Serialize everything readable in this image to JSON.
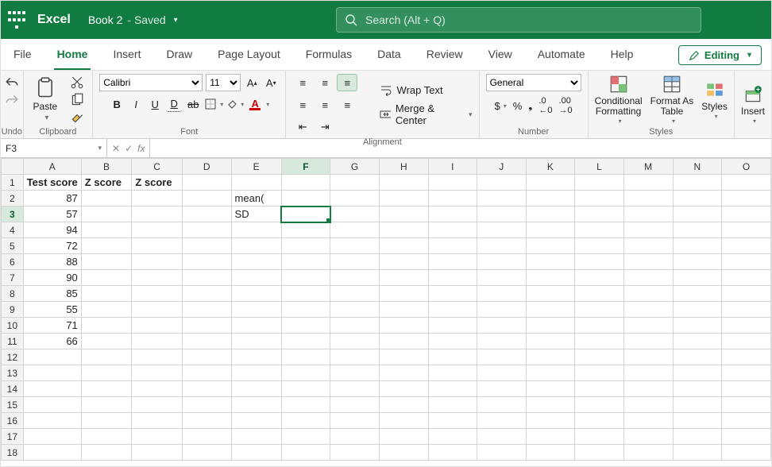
{
  "app": {
    "name": "Excel",
    "doc": "Book 2",
    "saved_label": "- Saved"
  },
  "search": {
    "placeholder": "Search (Alt + Q)"
  },
  "tabs": [
    "File",
    "Home",
    "Insert",
    "Draw",
    "Page Layout",
    "Formulas",
    "Data",
    "Review",
    "View",
    "Automate",
    "Help"
  ],
  "active_tab_index": 1,
  "mode_button": "Editing",
  "ribbon_groups": {
    "undo": "Undo",
    "clipboard": "Clipboard",
    "font": "Font",
    "alignment": "Alignment",
    "number": "Number",
    "styles": "Styles",
    "insert": "Insert"
  },
  "clipboard": {
    "paste": "Paste"
  },
  "font": {
    "name": "Calibri",
    "size": "11"
  },
  "alignment": {
    "wrap": "Wrap Text",
    "merge": "Merge & Center"
  },
  "number": {
    "format": "General"
  },
  "styles": {
    "cond": "Conditional\nFormatting",
    "fmt_tbl": "Format As\nTable",
    "cell": "Styles"
  },
  "cells": {
    "insert": "Insert"
  },
  "namebox": "F3",
  "fx_label": "fx",
  "columns": [
    "A",
    "B",
    "C",
    "D",
    "E",
    "F",
    "G",
    "H",
    "I",
    "J",
    "K",
    "L",
    "M",
    "N",
    "O"
  ],
  "row_count": 18,
  "selected": {
    "col": "F",
    "row": 3
  },
  "cells_data": {
    "A1": {
      "v": "Test score",
      "bold": true,
      "align": "left"
    },
    "B1": {
      "v": "Z score",
      "bold": true,
      "align": "left"
    },
    "C1": {
      "v": "Z score",
      "bold": true,
      "align": "left"
    },
    "E2": {
      "v": "mean(",
      "align": "left"
    },
    "E3": {
      "v": "SD",
      "align": "left"
    },
    "A2": {
      "v": "87",
      "align": "right"
    },
    "A3": {
      "v": "57",
      "align": "right"
    },
    "A4": {
      "v": "94",
      "align": "right"
    },
    "A5": {
      "v": "72",
      "align": "right"
    },
    "A6": {
      "v": "88",
      "align": "right"
    },
    "A7": {
      "v": "90",
      "align": "right"
    },
    "A8": {
      "v": "85",
      "align": "right"
    },
    "A9": {
      "v": "55",
      "align": "right"
    },
    "A10": {
      "v": "71",
      "align": "right"
    },
    "A11": {
      "v": "66",
      "align": "right"
    }
  }
}
